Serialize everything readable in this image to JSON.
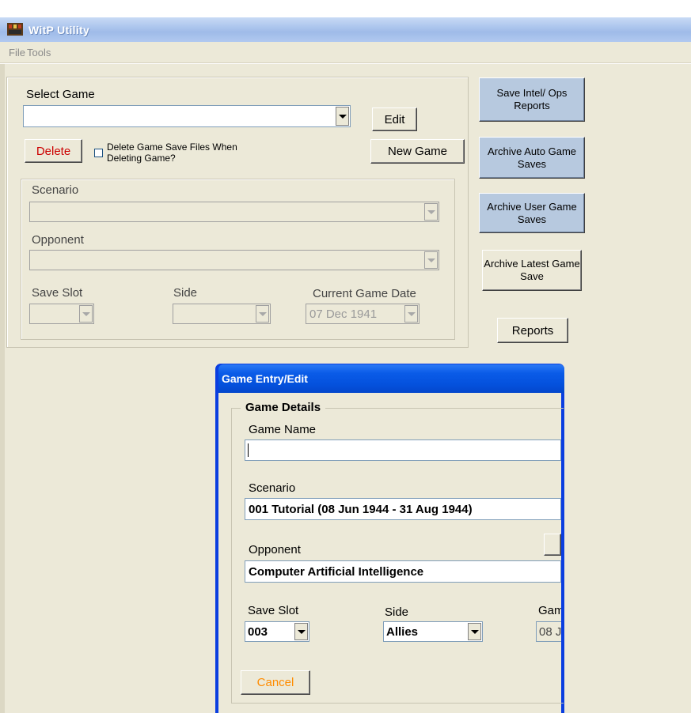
{
  "window": {
    "title": "WitP Utility"
  },
  "menu": [
    "File",
    "Tools"
  ],
  "select_game": {
    "label": "Select Game",
    "value": "",
    "edit_label": "Edit",
    "delete_label": "Delete",
    "delete_checkbox_label": "Delete Game Save Files When Deleting Game?",
    "new_game_label": "New Game"
  },
  "details": {
    "scenario_label": "Scenario",
    "opponent_label": "Opponent",
    "save_slot_label": "Save Slot",
    "side_label": "Side",
    "current_date_label": "Current Game Date",
    "current_date_value": "07 Dec 1941"
  },
  "side_buttons": {
    "save_intel": "Save Intel/ Ops Reports",
    "archive_auto": "Archive Auto Game Saves",
    "archive_user": "Archive User Game Saves",
    "archive_latest": "Archive Latest Game Save",
    "reports": "Reports"
  },
  "dialog": {
    "title": "Game Entry/Edit",
    "group_label": "Game Details",
    "game_name_label": "Game Name",
    "game_name_value": "",
    "scenario_label": "Scenario",
    "scenario_value": "001 Tutorial (08 Jun 1944 - 31 Aug 1944)",
    "opponent_label": "Opponent",
    "opponent_value": "Computer Artificial Intelligence",
    "save_slot_label": "Save Slot",
    "save_slot_value": "003",
    "side_label": "Side",
    "side_value": "Allies",
    "game_date_label_partial": "Gam",
    "game_date_value_partial": "08 J",
    "cancel_label": "Cancel"
  },
  "colors": {
    "delete_text": "#cc0000",
    "cancel_text": "#ff8c00",
    "blue_button": "#b7c9df",
    "dialog_title": "#0b5ce8"
  }
}
